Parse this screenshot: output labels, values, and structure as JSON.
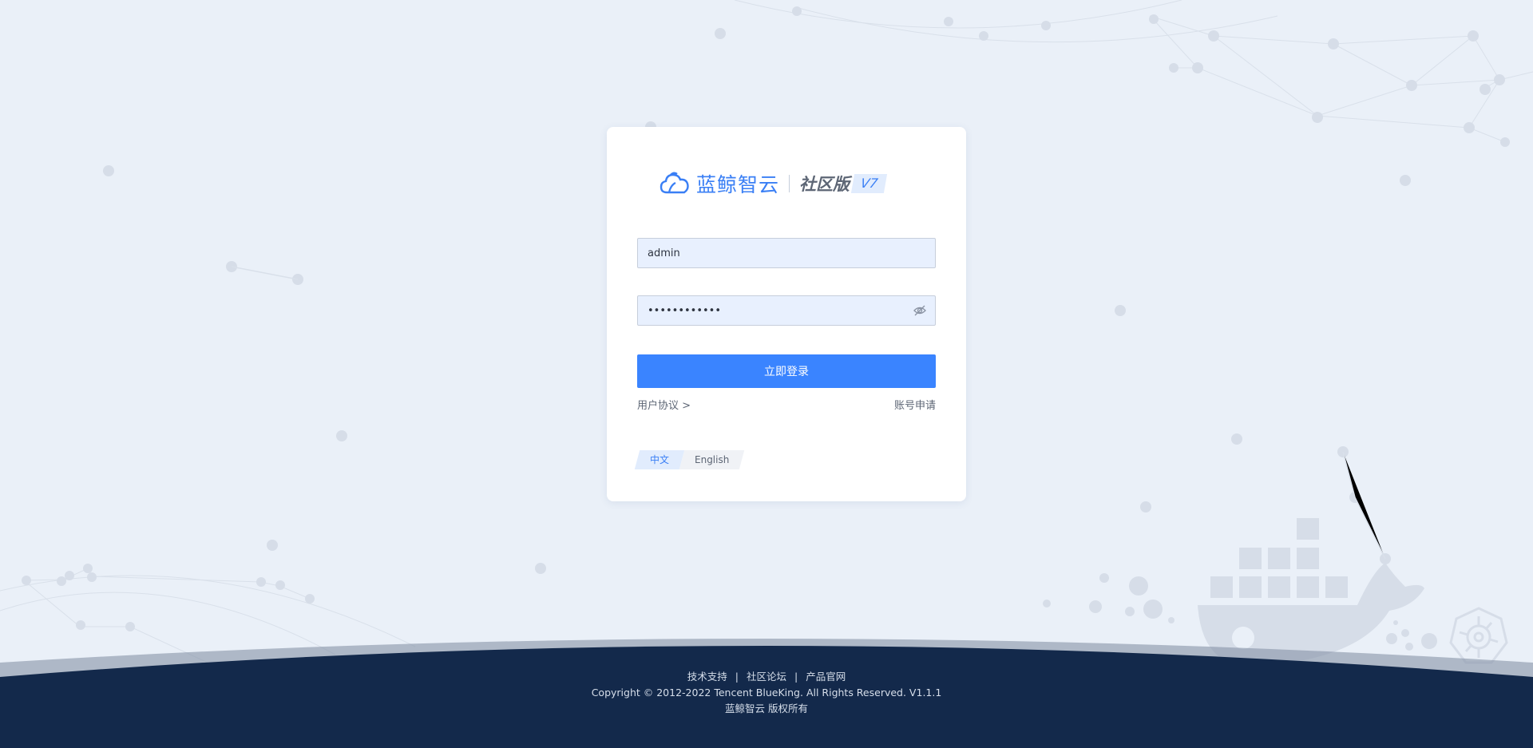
{
  "brand": {
    "name": "蓝鲸智云",
    "edition": "社区版",
    "version": "V7"
  },
  "login": {
    "username_value": "admin",
    "password_value": "••••••••••••",
    "submit_label": "立即登录",
    "agreement_link": "用户协议 >",
    "register_link": "账号申请"
  },
  "language": {
    "options": [
      "中文",
      "English"
    ],
    "selected": "中文"
  },
  "footer": {
    "links": [
      "技术支持",
      "社区论坛",
      "产品官网"
    ],
    "separator": "|",
    "copyright": "Copyright © 2012-2022 Tencent BlueKing. All Rights Reserved. V1.1.1",
    "rights": "蓝鲸智云 版权所有"
  },
  "colors": {
    "accent": "#3a84ff",
    "background": "#eaf0f8",
    "footer_bg": "#13294b"
  }
}
